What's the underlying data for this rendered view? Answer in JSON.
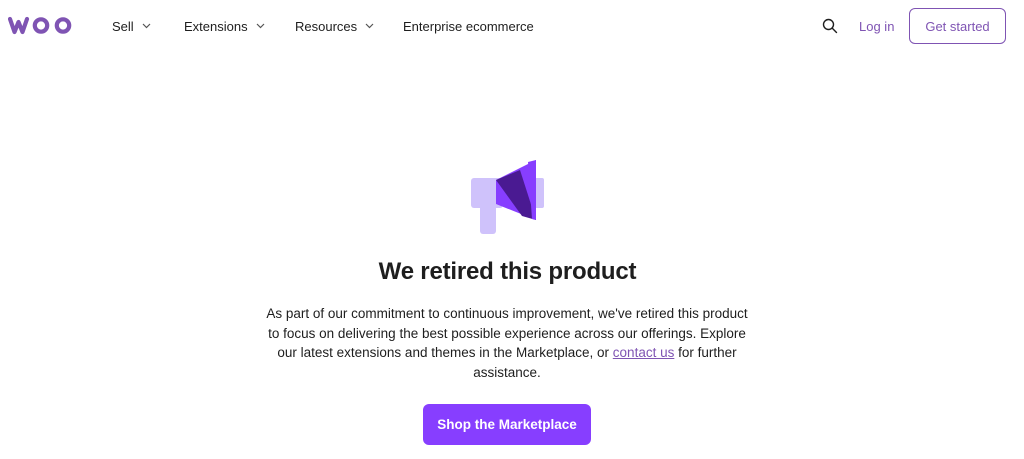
{
  "brand": {
    "logo_text": "woo",
    "accent": "#7f54b3",
    "cta_color": "#873eff"
  },
  "nav": {
    "sell": "Sell",
    "extensions": "Extensions",
    "resources": "Resources",
    "enterprise": "Enterprise ecommerce",
    "search_icon": "search-icon",
    "login": "Log in",
    "get_started": "Get started"
  },
  "main": {
    "icon": "megaphone-icon",
    "title": "We retired this product",
    "body_before_link": "As part of our commitment to continuous improvement, we've retired this product to focus on delivering the best possible experience across our offerings. Explore our latest extensions and themes in the Marketplace, or ",
    "link_text": "contact us",
    "body_after_link": " for further assistance.",
    "cta_label": "Shop the Marketplace"
  }
}
